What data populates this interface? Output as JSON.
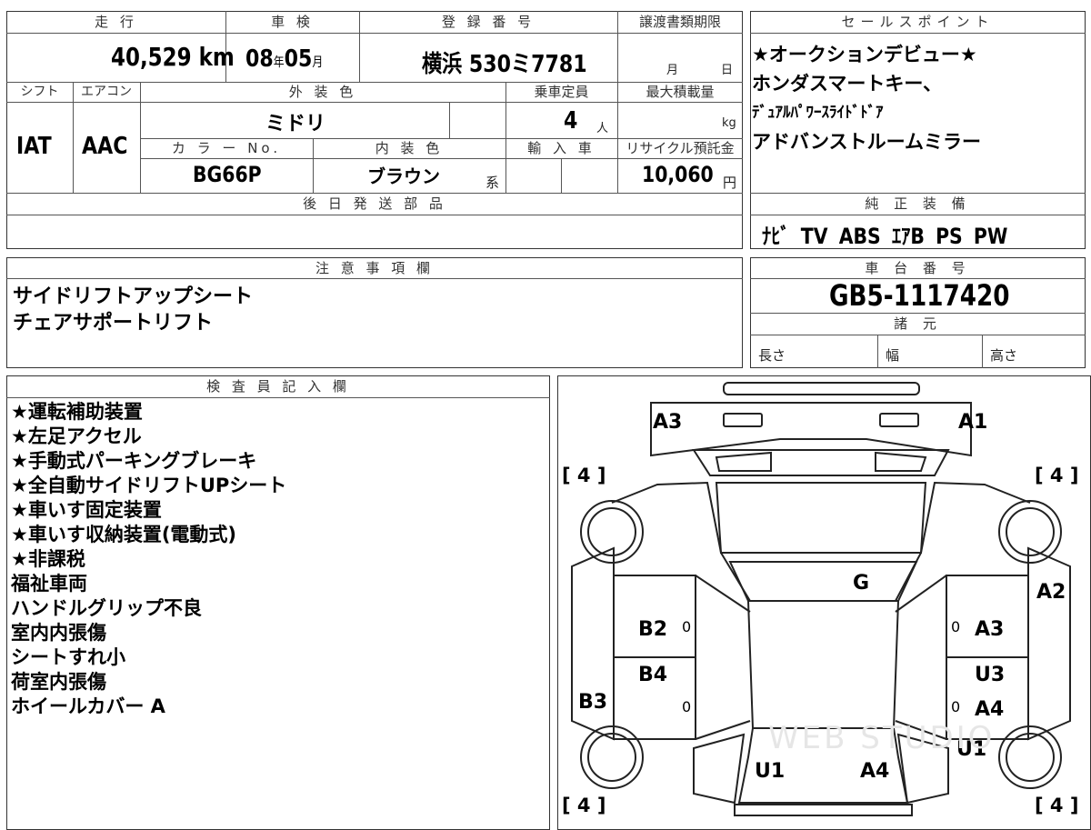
{
  "vehicle": {
    "mileage_header": "走 行",
    "mileage_value": "40,529",
    "mileage_unit": "km",
    "inspection_header": "車 検",
    "inspection_year": "08",
    "inspection_year_unit": "年",
    "inspection_month": "05",
    "inspection_month_unit": "月",
    "registration_header": "登 録 番 号",
    "registration_area": "横浜",
    "registration_number": "530ミ7781",
    "transfer_header": "譲渡書類期限",
    "transfer_month_unit": "月",
    "transfer_day_unit": "日",
    "shift_header": "シフト",
    "shift_value": "IAT",
    "aircon_header": "エアコン",
    "aircon_value": "AAC",
    "exterior_color_header": "外 装 色",
    "exterior_color_value": "ミドリ",
    "capacity_header": "乗車定員",
    "capacity_value": "4",
    "capacity_unit": "人",
    "max_load_header": "最大積載量",
    "max_load_unit": "kg",
    "color_no_header": "カ ラ ー No.",
    "color_no_value": "BG66P",
    "interior_color_header": "内 装 色",
    "interior_color_value": "ブラウン",
    "interior_color_suffix": "系",
    "import_header": "輸 入 車",
    "recycle_header": "リサイクル預託金",
    "recycle_value": "10,060",
    "recycle_unit": "円",
    "later_parts_header": "後 日 発 送 部 品"
  },
  "sales_points": {
    "header": "セールスポイント",
    "lines": [
      "★オークションデビュー★",
      "ホンダスマートキー、",
      "ﾃﾞｭｱﾙﾊﾟﾜｰｽﾗｲﾄﾞﾄﾞｱ",
      "アドバンストルームミラー"
    ]
  },
  "equipment": {
    "header": "純 正 装 備",
    "value": "ﾅﾋﾞ TV ABS ｴｱB PS PW"
  },
  "notes": {
    "header": "注 意 事 項 欄",
    "lines": [
      "サイドリフトアップシート",
      "チェアサポートリフト"
    ]
  },
  "chassis": {
    "header": "車 台 番 号",
    "value": "GB5-1117420"
  },
  "specs": {
    "header": "諸 元",
    "length_label": "長さ",
    "width_label": "幅",
    "height_label": "高さ"
  },
  "inspector": {
    "header": "検 査 員 記 入 欄",
    "lines": [
      "★運転補助装置",
      "★左足アクセル",
      "★手動式パーキングブレーキ",
      "★全自動サイドリフトUPシート",
      "★車いす固定装置",
      "★車いす収納装置(電動式)",
      "★非課税",
      "福祉車両",
      "ハンドルグリップ不良",
      "室内内張傷",
      "シートすれ小",
      "荷室内張傷",
      "ホイールカバー A"
    ]
  },
  "diagram": {
    "tire_front_left": "[ 4 ]",
    "tire_front_right": "[ 4 ]",
    "tire_rear_left": "[ 4 ]",
    "tire_rear_right": "[ 4 ]",
    "marks": {
      "front_bumper_left": "A3",
      "front_bumper_right": "A1",
      "windshield": "G",
      "right_front_fender": "A2",
      "left_front_door": "B2",
      "right_front_door": "A3",
      "left_rear_door": "B4",
      "right_rear_door_upper": "U3",
      "right_rear_door_lower": "A4",
      "left_rear_quarter": "B3",
      "right_rear_quarter": "U1",
      "rear_left": "U1",
      "rear_right": "A4"
    },
    "zero": "0",
    "watermark": "WEB STUDIO"
  }
}
